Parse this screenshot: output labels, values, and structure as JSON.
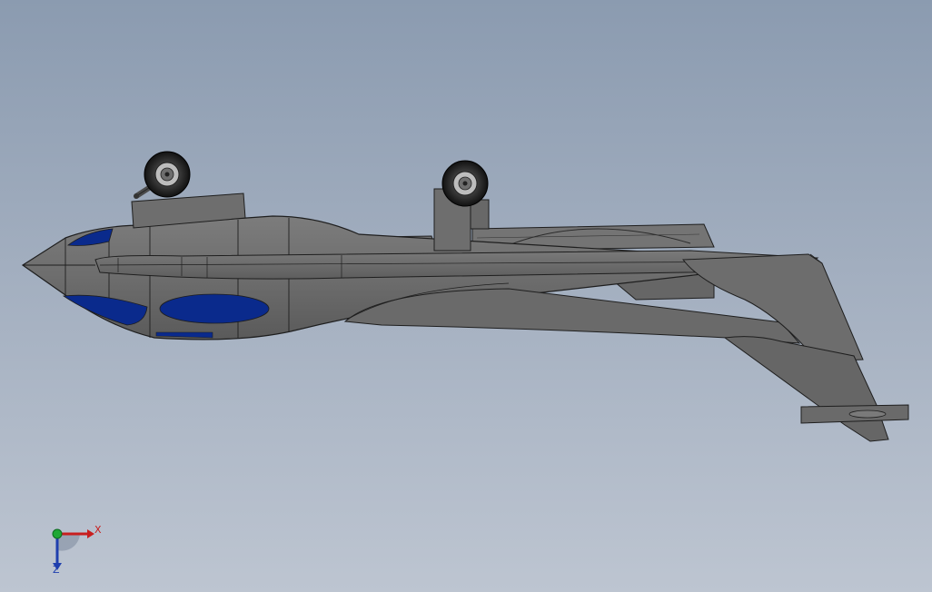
{
  "viewport": {
    "background_top": "#8b9bb0",
    "background_bottom": "#bdc5d1"
  },
  "model": {
    "body_color": "#6e6e6e",
    "window_color": "#0a2a8c",
    "edge_color": "#1e1e1e"
  },
  "triad": {
    "x_label": "X",
    "z_label": "Z",
    "x_color": "#c81e1e",
    "y_color": "#1fa834",
    "z_color": "#1f3fae"
  }
}
